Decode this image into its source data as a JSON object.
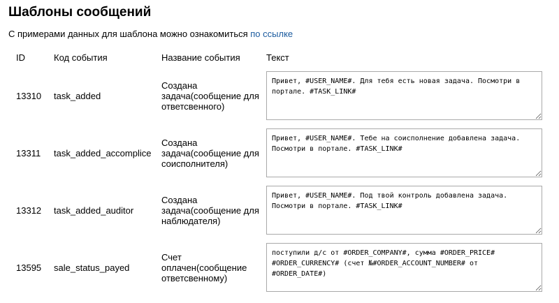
{
  "title": "Шаблоны сообщений",
  "intro": {
    "text": "С примерами данных для шаблона можно ознакомиться ",
    "link": "по ссылке"
  },
  "table": {
    "headers": [
      "ID",
      "Код события",
      "Название события",
      "Текст"
    ],
    "rows": [
      {
        "id": "13310",
        "code": "task_added",
        "name": "Создана задача(сообщение для ответсвенного)",
        "text": "Привет, #USER_NAME#. Для тебя есть новая задача. Посмотри в портале. #TASK_LINK#"
      },
      {
        "id": "13311",
        "code": "task_added_accomplice",
        "name": "Создана задача(сообщение для соисполнителя)",
        "text": "Привет, #USER_NAME#. Тебе на соисполнение добавлена задача. Посмотри в портале. #TASK_LINK#"
      },
      {
        "id": "13312",
        "code": "task_added_auditor",
        "name": "Создана задача(сообщение для наблюдателя)",
        "text": "Привет, #USER_NAME#. Под твой контроль добавлена задача. Посмотри в портале. #TASK_LINK#"
      },
      {
        "id": "13595",
        "code": "sale_status_payed",
        "name": "Счет оплачен(сообщение ответсвенному)",
        "text": "поступили д/с от #ORDER_COMPANY#, сумма #ORDER_PRICE# #ORDER_CURRENCY# (счет №#ORDER_ACCOUNT_NUMBER# от #ORDER_DATE#)"
      }
    ]
  }
}
